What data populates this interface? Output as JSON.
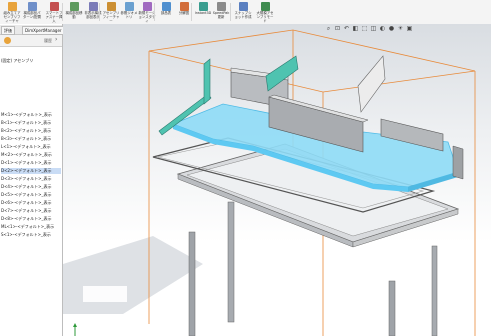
{
  "ribbon": {
    "buttons": [
      {
        "label": "組み立てアセンブリフィーチャ",
        "icon": "assembly-feature-icon",
        "color": "#e8a33b"
      },
      {
        "label": "構成部品パターン/配置",
        "icon": "component-pattern-icon",
        "color": "#6f8fc9"
      },
      {
        "label": "スマートファスナー挿入",
        "icon": "smart-fastener-icon",
        "color": "#c44f4f"
      },
      {
        "label": "構成部品移動",
        "icon": "move-component-icon",
        "color": "#5d9a5d"
      },
      {
        "label": "非表示構成部品表示",
        "icon": "show-hidden-icon",
        "color": "#7b7bb8"
      },
      {
        "label": "アセンブリ フィーチャー",
        "icon": "assembly-features-icon",
        "color": "#cc8f33"
      },
      {
        "label": "参照ジオメトリ",
        "icon": "reference-geometry-icon",
        "color": "#6aa0d0"
      },
      {
        "label": "新規モーションスタディ",
        "icon": "motion-study-icon",
        "color": "#a06ac0"
      },
      {
        "label": "部品表",
        "icon": "bom-icon",
        "color": "#4f8fcf"
      },
      {
        "label": "分解図",
        "icon": "exploded-view-icon",
        "color": "#d26d3a"
      },
      {
        "label": "Instant3D",
        "icon": "instant3d-icon",
        "color": "#3a9d8f"
      },
      {
        "label": "SpeedPak 更新",
        "icon": "speedpak-icon",
        "color": "#8a8a8a"
      },
      {
        "label": "スナップショット作成",
        "icon": "snapshot-icon",
        "color": "#5a7fc0"
      },
      {
        "label": "大規模アセンブリモード",
        "icon": "large-assembly-icon",
        "color": "#3f8b4f"
      }
    ]
  },
  "left_panel": {
    "tabs": [
      "評価",
      "DimXpertManager"
    ],
    "filter_label": "履歴",
    "tree_items": [
      "(固定) アセンブリ",
      "M<1>-<デフォルト>_表示",
      "B<1>-<デフォルト>_表示",
      "B<2>-<デフォルト>_表示",
      "B<3>-<デフォルト>_表示",
      "L<1>-<デフォルト>_表示",
      "M<2>-<デフォルト>_表示",
      "D<1>-<デフォルト>_表示",
      "D<2>-<デフォルト>_表示",
      "D<3>-<デフォルト>_表示",
      "D<4>-<デフォルト>_表示",
      "D<5>-<デフォルト>_表示",
      "D<6>-<デフォルト>_表示",
      "D<7>-<デフォルト>_表示",
      "D<8>-<デフォルト>_表示",
      "ML<1>-<デフォルト>_表示",
      "S<1>-<デフォルト>_表示"
    ],
    "selected_index": 8
  },
  "viewport": {
    "hud_icons": [
      "zoom-fit-icon",
      "zoom-area-icon",
      "previous-view-icon",
      "section-view-icon",
      "view-orientation-icon",
      "display-style-icon",
      "hide-show-icon",
      "appearance-icon",
      "scene-icon",
      "view-settings-icon"
    ],
    "bounding_box_color": "#e88a3a",
    "highlight_color": "#5ec9f2",
    "triad_color": "#2e9a3a"
  }
}
